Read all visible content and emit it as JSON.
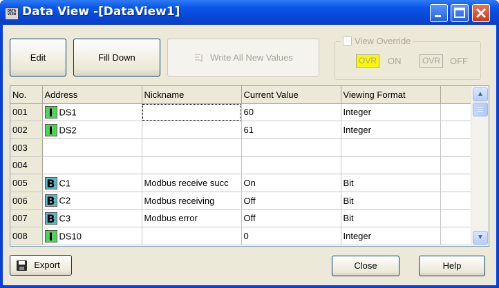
{
  "window": {
    "title": "Data View -[DataView1]",
    "app_icon_text": "DATA VIEW"
  },
  "toolbar": {
    "edit_label": "Edit",
    "fill_down_label": "Fill Down",
    "write_all_label": "Write All New Values"
  },
  "override": {
    "label": "View Override",
    "checked": false,
    "on_badge": "OVR",
    "on_label": "ON",
    "off_badge": "OVR",
    "off_label": "OFF"
  },
  "grid": {
    "columns": [
      "No.",
      "Address",
      "Nickname",
      "Current Value",
      "Viewing Format"
    ],
    "rows": [
      {
        "no": "001",
        "type": "I",
        "address": "DS1",
        "nickname": "",
        "value": "60",
        "format": "Integer"
      },
      {
        "no": "002",
        "type": "I",
        "address": "DS2",
        "nickname": "",
        "value": "61",
        "format": "Integer"
      },
      {
        "no": "003",
        "type": "",
        "address": "",
        "nickname": "",
        "value": "",
        "format": ""
      },
      {
        "no": "004",
        "type": "",
        "address": "",
        "nickname": "",
        "value": "",
        "format": ""
      },
      {
        "no": "005",
        "type": "B",
        "address": "C1",
        "nickname": "Modbus receive succ",
        "value": "On",
        "format": "Bit"
      },
      {
        "no": "006",
        "type": "B",
        "address": "C2",
        "nickname": "Modbus receiving",
        "value": "Off",
        "format": "Bit"
      },
      {
        "no": "007",
        "type": "B",
        "address": "C3",
        "nickname": "Modbus error",
        "value": "Off",
        "format": "Bit"
      },
      {
        "no": "008",
        "type": "I",
        "address": "DS10",
        "nickname": "",
        "value": "0",
        "format": "Integer"
      }
    ]
  },
  "footer": {
    "export_label": "Export",
    "close_label": "Close",
    "help_label": "Help"
  },
  "colors": {
    "titlebar": "#0a56e8",
    "integer_icon": "#52d25a",
    "bit_icon": "#5fb6c6",
    "ovr_on_highlight": "#f8f800",
    "dialog_bg": "#ece9d8"
  }
}
